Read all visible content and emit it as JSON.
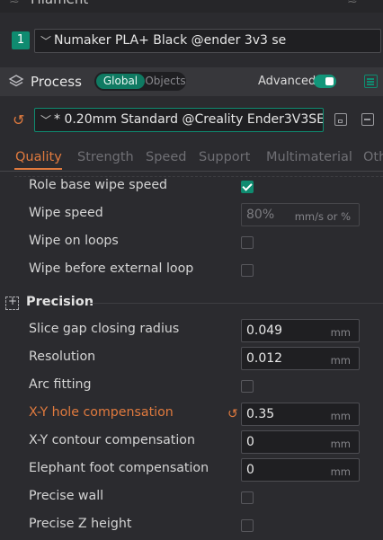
{
  "filament": {
    "title": "Filament",
    "index": "1",
    "preset": "Numaker PLA+ Black @ender 3v3 se"
  },
  "process": {
    "title": "Process",
    "scope_global": "Global",
    "scope_objects": "Objects",
    "advanced_label": "Advanced",
    "advanced_on": true,
    "preset": "* 0.20mm Standard @Creality Ender3V3SE ..."
  },
  "tabs": [
    "Quality",
    "Strength",
    "Speed",
    "Support",
    "Multimaterial",
    "Oth"
  ],
  "active_tab": "Quality",
  "wipe_options": [
    {
      "label": "Role base wipe speed",
      "type": "checkbox",
      "checked": true
    },
    {
      "label": "Wipe speed",
      "type": "field",
      "value": "80%",
      "unit": "mm/s or %",
      "disabled": true
    },
    {
      "label": "Wipe on loops",
      "type": "checkbox",
      "checked": false
    },
    {
      "label": "Wipe before external loop",
      "type": "checkbox",
      "checked": false
    }
  ],
  "precision": {
    "title": "Precision",
    "options": [
      {
        "label": "Slice gap closing radius",
        "type": "field",
        "value": "0.049",
        "unit": "mm"
      },
      {
        "label": "Resolution",
        "type": "field",
        "value": "0.012",
        "unit": "mm"
      },
      {
        "label": "Arc fitting",
        "type": "checkbox",
        "checked": false
      },
      {
        "label": "X-Y hole compensation",
        "type": "field",
        "value": "0.35",
        "unit": "mm",
        "changed": true
      },
      {
        "label": "X-Y contour compensation",
        "type": "field",
        "value": "0",
        "unit": "mm"
      },
      {
        "label": "Elephant foot compensation",
        "type": "field",
        "value": "0",
        "unit": "mm"
      },
      {
        "label": "Precise wall",
        "type": "checkbox",
        "checked": false
      },
      {
        "label": "Precise Z height",
        "type": "checkbox",
        "checked": false
      }
    ]
  },
  "colors": {
    "accent": "#0f8b70",
    "changed": "#e07a3e",
    "background": "#2b2b2f"
  }
}
